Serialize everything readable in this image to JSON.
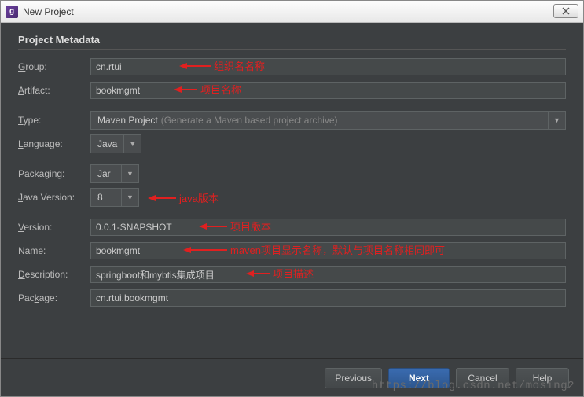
{
  "window": {
    "title": "New Project"
  },
  "section": {
    "heading": "Project Metadata"
  },
  "labels": {
    "group": "Group:",
    "artifact": "Artifact:",
    "type": "Type:",
    "language": "Language:",
    "packaging": "Packaging:",
    "javaVersion": "Java Version:",
    "version": "Version:",
    "name": "Name:",
    "description": "Description:",
    "package": "Package:"
  },
  "underlineChars": {
    "group": "G",
    "artifact": "A",
    "type": "T",
    "language": "L",
    "javaVersion": "J",
    "version": "V",
    "name": "N",
    "description": "D",
    "package": "k"
  },
  "values": {
    "group": "cn.rtui",
    "artifact": "bookmgmt",
    "typeMain": "Maven Project",
    "typeHint": "(Generate a Maven based project archive)",
    "language": "Java",
    "packaging": "Jar",
    "javaVersion": "8",
    "version": "0.0.1-SNAPSHOT",
    "name": "bookmgmt",
    "description": "springboot和mybtis集成项目",
    "package": "cn.rtui.bookmgmt"
  },
  "annotations": {
    "group": "组织名名称",
    "artifact": "项目名称",
    "javaVersion": "java版本",
    "version": "项目版本",
    "name": "maven项目显示名称，默认与项目名称相同即可",
    "description": "项目描述"
  },
  "buttons": {
    "previous": "Previous",
    "next": "Next",
    "cancel": "Cancel",
    "help": "Help"
  },
  "watermark": "https://blog.csdn.net/mosing2"
}
